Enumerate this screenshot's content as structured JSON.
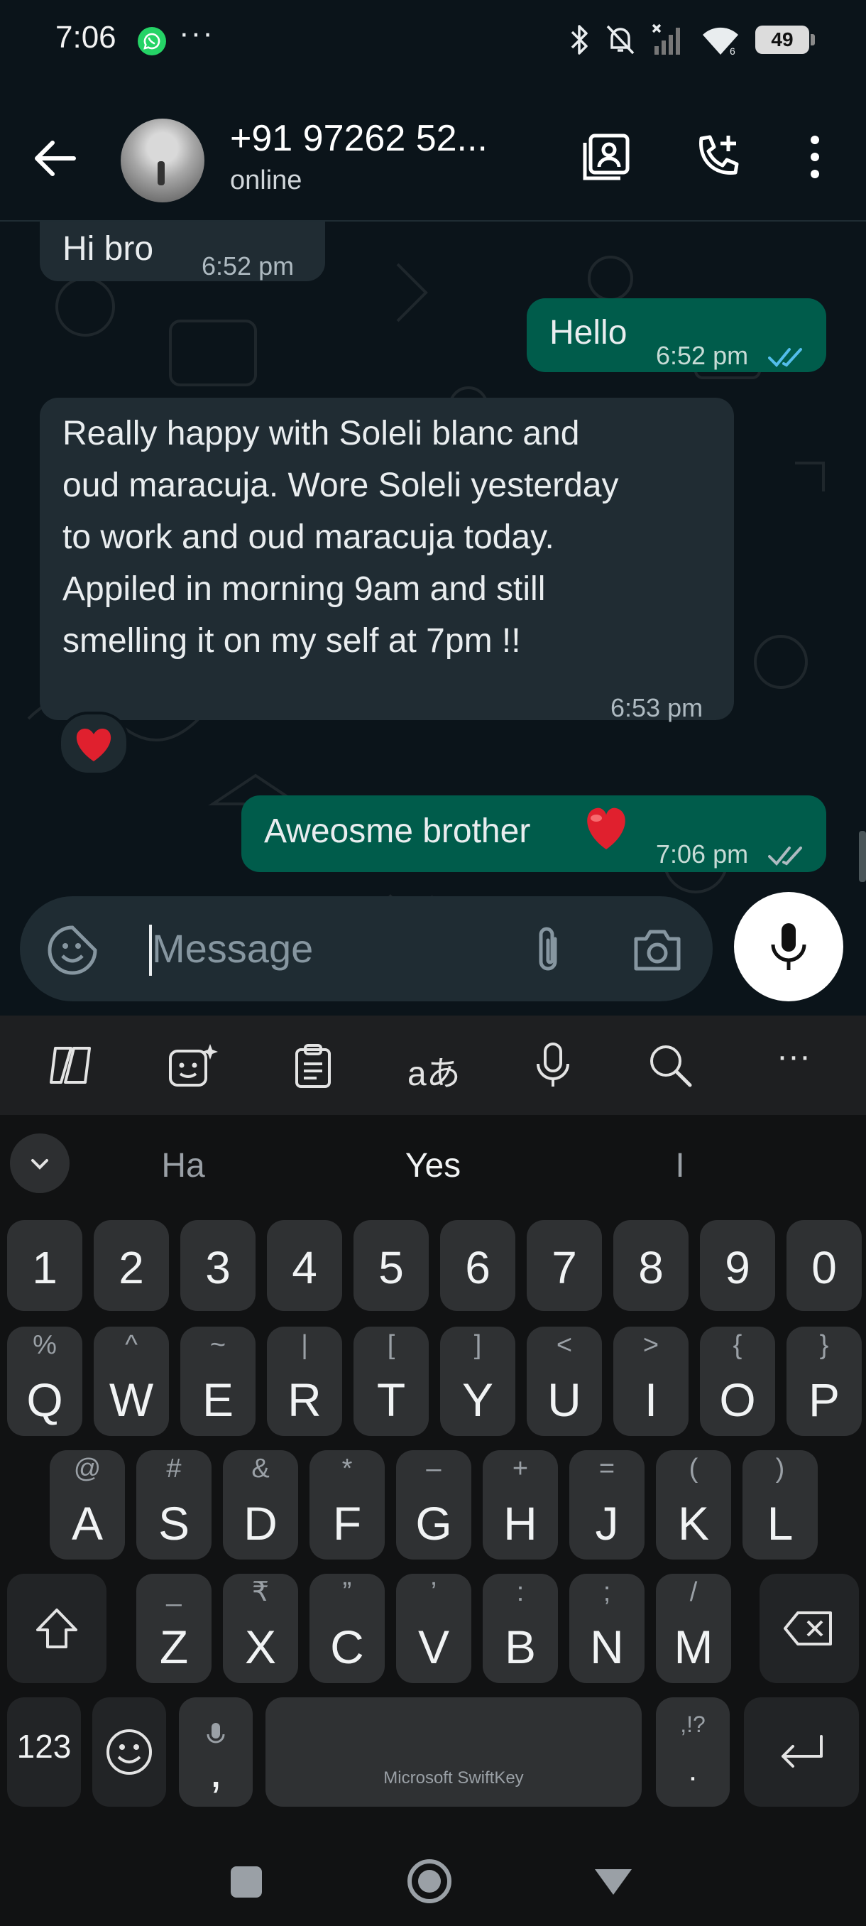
{
  "status_bar": {
    "time": "7:06",
    "notification_dots": "···",
    "battery_level": "49",
    "network_label": "6"
  },
  "header": {
    "contact_name": "+91 97262 52...",
    "contact_status": "online"
  },
  "messages": [
    {
      "direction": "incoming",
      "text": "Hi bro",
      "time": "6:52 pm"
    },
    {
      "direction": "outgoing",
      "text": "Hello",
      "time": "6:52 pm",
      "status": "read"
    },
    {
      "direction": "incoming",
      "text": "Really happy with Soleli blanc and oud maracuja. Wore Soleli yesterday to work and oud maracuja today. Appiled in morning 9am and still smelling it on my self at 7pm !!",
      "lines": [
        "Really happy with Soleli blanc and",
        "oud maracuja. Wore Soleli yesterday",
        "to work and oud maracuja today.",
        "Appiled in morning 9am and still",
        "smelling it on my self at 7pm !!"
      ],
      "time": "6:53 pm",
      "reaction": "heart"
    },
    {
      "direction": "outgoing",
      "text": "Aweosme brother",
      "emoji": "heart",
      "time": "7:06 pm",
      "status": "delivered"
    }
  ],
  "composer": {
    "placeholder": "Message",
    "value": ""
  },
  "keyboard": {
    "toolbar": {
      "translate_label": "aあ",
      "more_label": "···"
    },
    "suggestions": [
      "Ha",
      "Yes",
      "I"
    ],
    "number_row": [
      "1",
      "2",
      "3",
      "4",
      "5",
      "6",
      "7",
      "8",
      "9",
      "0"
    ],
    "row1": [
      {
        "key": "Q",
        "alt": "%"
      },
      {
        "key": "W",
        "alt": "^"
      },
      {
        "key": "E",
        "alt": "~"
      },
      {
        "key": "R",
        "alt": "|"
      },
      {
        "key": "T",
        "alt": "["
      },
      {
        "key": "Y",
        "alt": "]"
      },
      {
        "key": "U",
        "alt": "<"
      },
      {
        "key": "I",
        "alt": ">"
      },
      {
        "key": "O",
        "alt": "{"
      },
      {
        "key": "P",
        "alt": "}"
      }
    ],
    "row2": [
      {
        "key": "A",
        "alt": "@"
      },
      {
        "key": "S",
        "alt": "#"
      },
      {
        "key": "D",
        "alt": "&"
      },
      {
        "key": "F",
        "alt": "*"
      },
      {
        "key": "G",
        "alt": "–"
      },
      {
        "key": "H",
        "alt": "+"
      },
      {
        "key": "J",
        "alt": "="
      },
      {
        "key": "K",
        "alt": "("
      },
      {
        "key": "L",
        "alt": ")"
      }
    ],
    "row3": [
      {
        "key": "Z",
        "alt": "_"
      },
      {
        "key": "X",
        "alt": "₹"
      },
      {
        "key": "C",
        "alt": "”"
      },
      {
        "key": "V",
        "alt": "’"
      },
      {
        "key": "B",
        "alt": ":"
      },
      {
        "key": "N",
        "alt": ";"
      },
      {
        "key": "M",
        "alt": "/"
      }
    ],
    "bottom_row": {
      "numbers_key": "123",
      "comma_key": ",",
      "space_label": "Microsoft SwiftKey",
      "period_alt": ",!?",
      "period_key": "."
    }
  },
  "colors": {
    "background": "#0b141a",
    "incoming_bubble": "#202c33",
    "outgoing_bubble": "#005c4b",
    "read_ticks": "#53bdeb",
    "delivered_ticks": "#aebac1",
    "keyboard_key": "#2f3133"
  },
  "icons": [
    "whatsapp-icon",
    "bluetooth-icon",
    "mute-icon",
    "signal-icon",
    "wifi-icon",
    "back-arrow-icon",
    "contact-card-icon",
    "add-call-icon",
    "more-vert-icon",
    "sticker-icon",
    "attach-icon",
    "camera-icon",
    "mic-icon",
    "copilot-icon",
    "ai-emoji-icon",
    "clipboard-icon",
    "keyboard-mic-icon",
    "search-icon",
    "chevron-down-icon",
    "shift-icon",
    "backspace-icon",
    "smiley-icon",
    "enter-icon",
    "nav-recents-icon",
    "nav-home-icon",
    "nav-back-icon"
  ]
}
